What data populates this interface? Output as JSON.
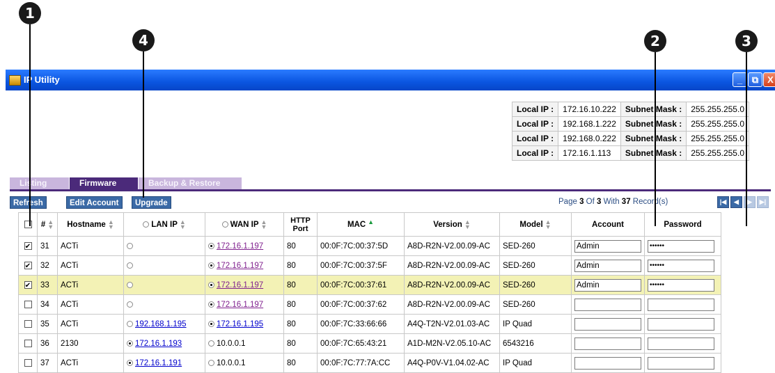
{
  "callouts": [
    "1",
    "2",
    "3",
    "4"
  ],
  "window": {
    "title": "IP Utility",
    "icon": "app-icon",
    "buttons": {
      "minimize": "_",
      "maximize": "⧉",
      "close": "X"
    }
  },
  "ip_info": [
    {
      "local_label": "Local IP :",
      "local_ip": "172.16.10.222",
      "mask_label": "Subnet Mask :",
      "mask": "255.255.255.0"
    },
    {
      "local_label": "Local IP :",
      "local_ip": "192.168.1.222",
      "mask_label": "Subnet Mask :",
      "mask": "255.255.255.0"
    },
    {
      "local_label": "Local IP :",
      "local_ip": "192.168.0.222",
      "mask_label": "Subnet Mask :",
      "mask": "255.255.255.0"
    },
    {
      "local_label": "Local IP :",
      "local_ip": "172.16.1.113",
      "mask_label": "Subnet Mask :",
      "mask": "255.255.255.0"
    }
  ],
  "tabs": [
    {
      "label": "Listing",
      "active": false
    },
    {
      "label": "Firmware",
      "active": true
    },
    {
      "label": "Backup & Restore",
      "active": false
    }
  ],
  "toolbar": {
    "refresh": "Refresh",
    "edit_account": "Edit Account",
    "upgrade": "Upgrade",
    "page_prefix": "Page ",
    "page": "3",
    "page_mid": " Of ",
    "pages": "3",
    "with_text": " With ",
    "records": "37",
    "records_suffix": " Record(s)"
  },
  "columns": {
    "num": "#",
    "hostname": "Hostname",
    "lan_ip": "LAN IP",
    "wan_ip": "WAN IP",
    "http_port": "HTTP Port",
    "mac": "MAC",
    "version": "Version",
    "model": "Model",
    "account": "Account",
    "password": "Password"
  },
  "rows": [
    {
      "num": "31",
      "hostname": "ACTi",
      "lan_ip": "",
      "wan_ip": "172.16.1.197",
      "port": "80",
      "mac": "00:0F:7C:00:37:5D",
      "version": "A8D-R2N-V2.00.09-AC",
      "model": "SED-260",
      "account": "Admin",
      "password": "••••••"
    },
    {
      "num": "32",
      "hostname": "ACTi",
      "lan_ip": "",
      "wan_ip": "172.16.1.197",
      "port": "80",
      "mac": "00:0F:7C:00:37:5F",
      "version": "A8D-R2N-V2.00.09-AC",
      "model": "SED-260",
      "account": "Admin",
      "password": "••••••"
    },
    {
      "num": "33",
      "hostname": "ACTi",
      "lan_ip": "",
      "wan_ip": "172.16.1.197",
      "port": "80",
      "mac": "00:0F:7C:00:37:61",
      "version": "A8D-R2N-V2.00.09-AC",
      "model": "SED-260",
      "account": "Admin",
      "password": "••••••"
    },
    {
      "num": "34",
      "hostname": "ACTi",
      "lan_ip": "",
      "wan_ip": "172.16.1.197",
      "port": "80",
      "mac": "00:0F:7C:00:37:62",
      "version": "A8D-R2N-V2.00.09-AC",
      "model": "SED-260",
      "account": "",
      "password": ""
    },
    {
      "num": "35",
      "hostname": "ACTi",
      "lan_ip": "192.168.1.195",
      "wan_ip": "172.16.1.195",
      "port": "80",
      "mac": "00:0F:7C:33:66:66",
      "version": "A4Q-T2N-V2.01.03-AC",
      "model": "IP Quad",
      "account": "",
      "password": ""
    },
    {
      "num": "36",
      "hostname": "2130",
      "lan_ip": "172.16.1.193",
      "wan_ip": "10.0.0.1",
      "port": "80",
      "mac": "00:0F:7C:65:43:21",
      "version": "A1D-M2N-V2.05.10-AC",
      "model": "6543216",
      "account": "",
      "password": ""
    },
    {
      "num": "37",
      "hostname": "ACTi",
      "lan_ip": "172.16.1.191",
      "wan_ip": "10.0.0.1",
      "port": "80",
      "mac": "00:0F:7C:77:7A:CC",
      "version": "A4Q-P0V-V1.04.02-AC",
      "model": "IP Quad",
      "account": "",
      "password": ""
    }
  ],
  "colors": {
    "titlebar": "#0a55e0",
    "tab_active": "#4b2a7a",
    "button": "#3b6aa6",
    "highlight_row": "#f3f2b5"
  }
}
